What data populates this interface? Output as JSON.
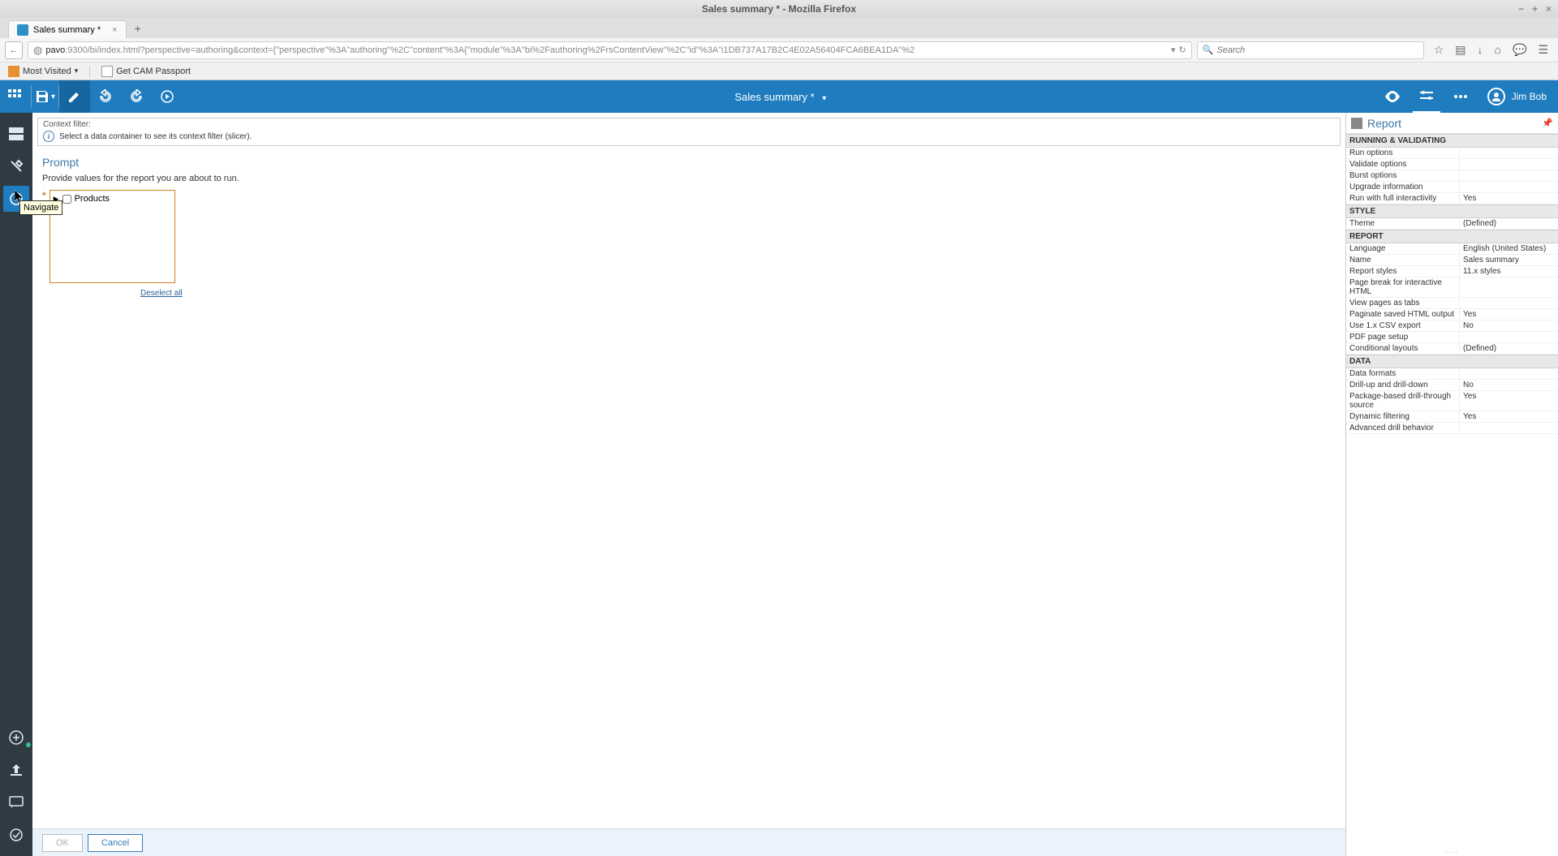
{
  "os_title": "Sales summary * - Mozilla Firefox",
  "browser": {
    "tab_title": "Sales summary *",
    "url_host": "pavo",
    "url_rest": ":9300/bi/index.html?perspective=authoring&context={\"perspective\"%3A\"authoring\"%2C\"content\"%3A{\"module\"%3A\"bi%2Fauthoring%2FrsContentView\"%2C\"id\"%3A\"i1DB737A17B2C4E02A56404FCA6BEA1DA\"%2",
    "search_placeholder": "Search"
  },
  "bookmarks": {
    "most_visited": "Most Visited",
    "cam": "Get CAM Passport"
  },
  "app": {
    "title": "Sales summary *",
    "user": "Jim Bob"
  },
  "tooltip": "Navigate",
  "context_filter": {
    "label": "Context filter:",
    "msg": "Select a data container to see its context filter (slicer)."
  },
  "prompt": {
    "title": "Prompt",
    "desc": "Provide values for the report you are about to run.",
    "tree_item": "Products",
    "deselect": "Deselect all",
    "ok": "OK",
    "cancel": "Cancel"
  },
  "rp": {
    "title": "Report",
    "sections": {
      "running": "RUNNING & VALIDATING",
      "style": "STYLE",
      "report": "REPORT",
      "data": "DATA"
    },
    "rows": {
      "run_options": "Run options",
      "validate_options": "Validate options",
      "burst_options": "Burst options",
      "upgrade_info": "Upgrade information",
      "run_interactivity": "Run with full interactivity",
      "run_interactivity_v": "Yes",
      "theme": "Theme",
      "theme_v": "(Defined)",
      "language": "Language",
      "language_v": "English (United States)",
      "name": "Name",
      "name_v": "Sales summary",
      "report_styles": "Report styles",
      "report_styles_v": "11.x styles",
      "page_break": "Page break for interactive HTML",
      "view_pages_tabs": "View pages as tabs",
      "paginate": "Paginate saved HTML output",
      "paginate_v": "Yes",
      "csv": "Use 1.x CSV export",
      "csv_v": "No",
      "pdf": "PDF page setup",
      "cond_layouts": "Conditional layouts",
      "cond_layouts_v": "(Defined)",
      "data_formats": "Data formats",
      "drill": "Drill-up and drill-down",
      "drill_v": "No",
      "package_drill": "Package-based drill-through source",
      "package_drill_v": "Yes",
      "dynamic_filter": "Dynamic filtering",
      "dynamic_filter_v": "Yes",
      "adv_drill": "Advanced drill behavior"
    }
  }
}
